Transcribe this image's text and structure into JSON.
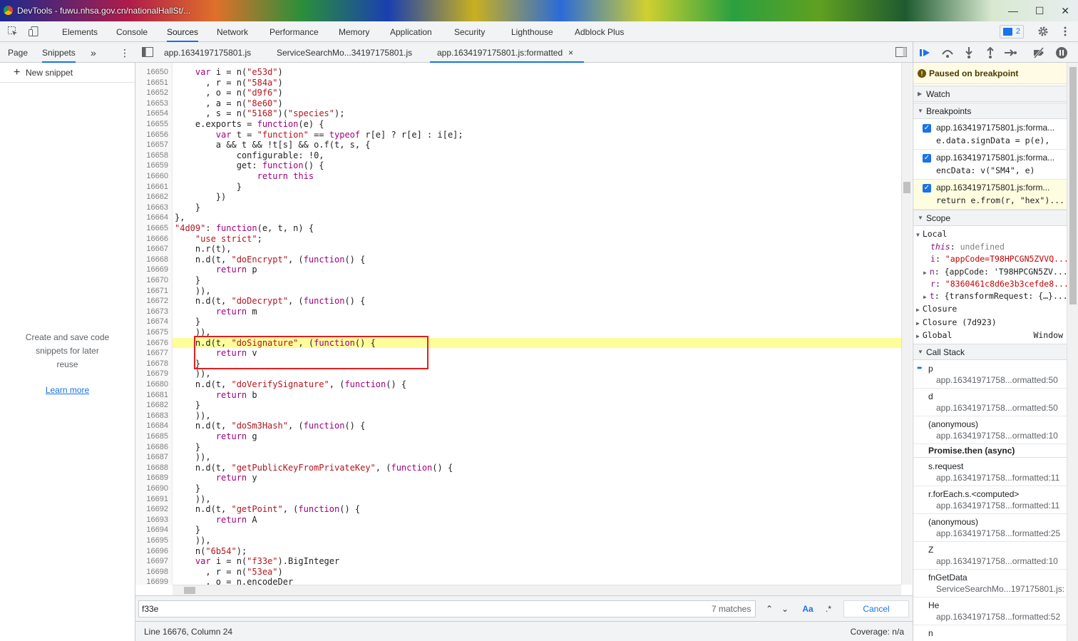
{
  "window": {
    "title": "DevTools - fuwu.nhsa.gov.cn/nationalHallSt/...",
    "buttons": [
      "—",
      "☐",
      "✕"
    ]
  },
  "main_tabs": [
    "Elements",
    "Console",
    "Sources",
    "Network",
    "Performance",
    "Memory",
    "Application",
    "Security",
    "Lighthouse",
    "Adblock Plus"
  ],
  "active_main_tab": "Sources",
  "issues_count": "2",
  "nav_tabs": {
    "page": "Page",
    "snippets": "Snippets",
    "more": "»",
    "menu": "⋮"
  },
  "file_tabs": [
    "app.1634197175801.js",
    "ServiceSearchMo...34197175801.js",
    "app.1634197175801.js:formatted"
  ],
  "close_tab": "×",
  "navigator": {
    "new_snippet": "New snippet",
    "message_lines": [
      "Create and save code",
      "snippets for later",
      "reuse"
    ],
    "learn_more": "Learn more"
  },
  "editor": {
    "first_line": 16650,
    "lines": [
      "    var i = n(\"e53d\")",
      "      , r = n(\"584a\")",
      "      , o = n(\"d9f6\")",
      "      , a = n(\"8e60\")",
      "      , s = n(\"5168\")(\"species\");",
      "    e.exports = function(e) {",
      "        var t = \"function\" == typeof r[e] ? r[e] : i[e];",
      "        a && t && !t[s] && o.f(t, s, {",
      "            configurable: !0,",
      "            get: function() {",
      "                return this",
      "            }",
      "        })",
      "    }",
      "},",
      "\"4d09\": function(e, t, n) {",
      "    \"use strict\";",
      "    n.r(t),",
      "    n.d(t, \"doEncrypt\", (function() {",
      "        return p",
      "    }",
      "    )),",
      "    n.d(t, \"doDecrypt\", (function() {",
      "        return m",
      "    }",
      "    )),",
      "    n.d(t, \"doSignature\", (function() {",
      "        return v",
      "    }",
      "    )),",
      "    n.d(t, \"doVerifySignature\", (function() {",
      "        return b",
      "    }",
      "    )),",
      "    n.d(t, \"doSm3Hash\", (function() {",
      "        return g",
      "    }",
      "    )),",
      "    n.d(t, \"getPublicKeyFromPrivateKey\", (function() {",
      "        return y",
      "    }",
      "    )),",
      "    n.d(t, \"getPoint\", (function() {",
      "        return A",
      "    }",
      "    )),",
      "    n(\"6b54\");",
      "    var i = n(\"f33e\").BigInteger",
      "      , r = n(\"53ea\")",
      "      , o = n.encodeDer",
      ""
    ],
    "highlight_line": 16676
  },
  "search": {
    "query": "f33e",
    "matches": "7 matches",
    "case_label": "Aa",
    "regex_label": ".*",
    "cancel": "Cancel"
  },
  "status": {
    "position": "Line 16676, Column 24",
    "coverage": "Coverage: n/a"
  },
  "debugger": {
    "paused": "Paused on breakpoint",
    "watch": "Watch",
    "breakpoints_title": "Breakpoints",
    "breakpoints": [
      {
        "file": "app.1634197175801.js:forma...",
        "code": "e.data.signData = p(e),"
      },
      {
        "file": "app.1634197175801.js:forma...",
        "code": "encData: v(\"SM4\", e)"
      },
      {
        "file": "app.1634197175801.js:form...",
        "code": "return e.from(r, \"hex\")..."
      }
    ],
    "scope_title": "Scope",
    "scope": {
      "local": "Local",
      "this_k": "this",
      "this_v": "undefined",
      "i_k": "i",
      "i_v": "\"appCode=T98HPCGN5ZVVQ...",
      "n_k": "n",
      "n_v": "{appCode: 'T98HPCGN5ZV...",
      "r_k": "r",
      "r_v": "\"8360461c8d6e3b3cefde8...",
      "t_k": "t",
      "t_v": "{transformRequest: {…}...",
      "closure1": "Closure",
      "closure2": "Closure (7d923)",
      "global": "Global",
      "global_v": "Window"
    },
    "callstack_title": "Call Stack",
    "callstack": [
      {
        "fn": "p",
        "loc": "app.16341971758...ormatted:50"
      },
      {
        "fn": "d",
        "loc": "app.16341971758...ormatted:50"
      },
      {
        "fn": "(anonymous)",
        "loc": "app.16341971758...ormatted:10"
      },
      {
        "fn": "s.request",
        "loc": "app.16341971758...formatted:11"
      },
      {
        "fn": "r.forEach.s.<computed>",
        "loc": "app.16341971758...formatted:11"
      },
      {
        "fn": "(anonymous)",
        "loc": "app.16341971758...formatted:25"
      },
      {
        "fn": "Z",
        "loc": "app.16341971758...ormatted:10"
      },
      {
        "fn": "fnGetData",
        "loc": "ServiceSearchMo...197175801.js:"
      },
      {
        "fn": "He",
        "loc": "app.16341971758...formatted:52"
      },
      {
        "fn": "n",
        "loc": ""
      }
    ],
    "async_label": "Promise.then (async)"
  }
}
